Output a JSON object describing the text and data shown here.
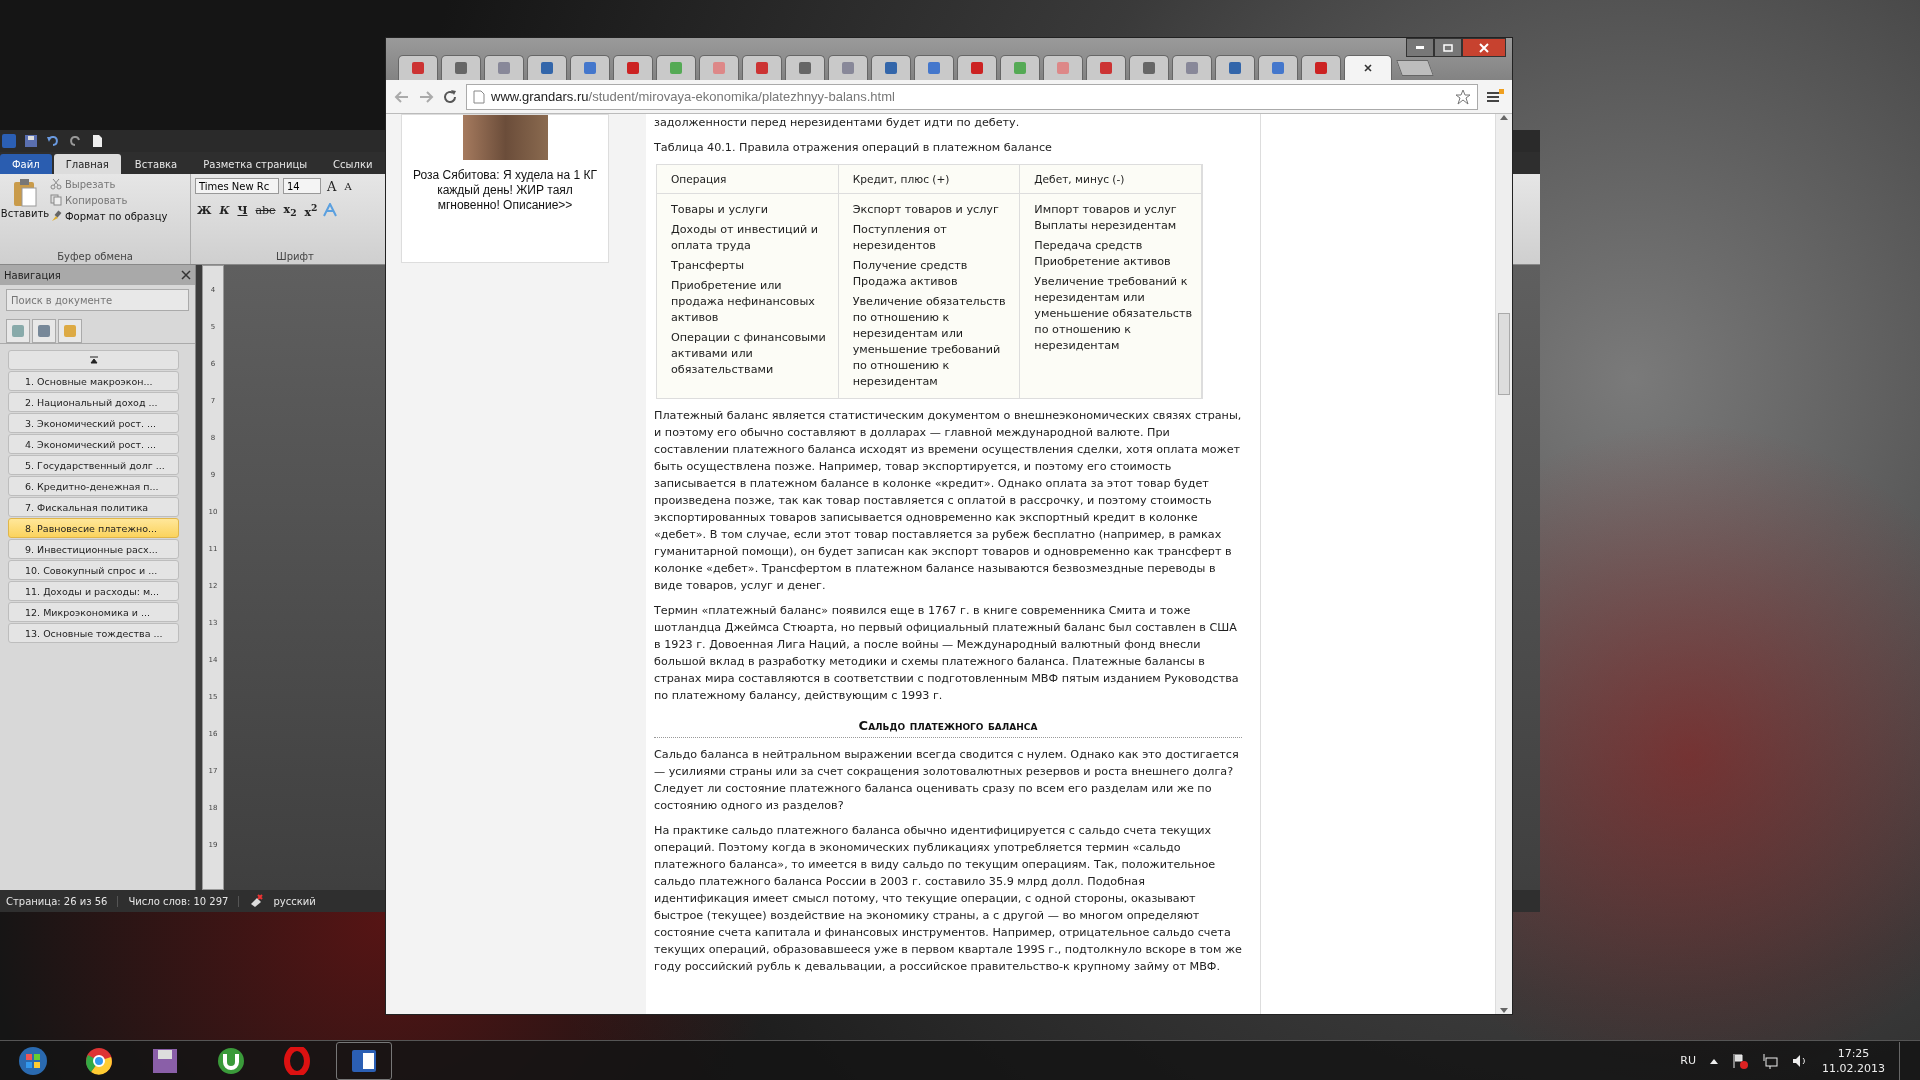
{
  "word": {
    "ribbon_tabs": [
      {
        "label": "Файл",
        "kind": "file",
        "selected": false
      },
      {
        "label": "Главная",
        "kind": "tab",
        "selected": true
      },
      {
        "label": "Вставка",
        "kind": "tab",
        "selected": false
      },
      {
        "label": "Разметка страницы",
        "kind": "tab",
        "selected": false
      },
      {
        "label": "Ссылки",
        "kind": "tab",
        "selected": false
      }
    ],
    "clipboard": {
      "paste": "Вставить",
      "cut": "Вырезать",
      "copy": "Копировать",
      "format_painter": "Формат по образцу",
      "group_label": "Буфер обмена"
    },
    "font": {
      "name": "Times New Rc",
      "size": "14",
      "grow": "A",
      "shrink": "A",
      "bold": "Ж",
      "italic": "К",
      "underline": "Ч",
      "strike": "abe",
      "subscript": "x$_{2}$",
      "superscript": "x$^{2}$",
      "group_label": "Шрифт"
    },
    "navigation": {
      "title": "Навигация",
      "search": {
        "placeholder": "Поиск в документе"
      },
      "items": [
        {
          "label": "1. Основные макроэкон...",
          "selected": false
        },
        {
          "label": "2. Национальный доход ...",
          "selected": false
        },
        {
          "label": "3. Экономический рост. ...",
          "selected": false
        },
        {
          "label": "4. Экономический рост. ...",
          "selected": false
        },
        {
          "label": "5. Государственный долг ...",
          "selected": false
        },
        {
          "label": "6. Кредитно-денежная п...",
          "selected": false
        },
        {
          "label": "7. Фискальная политика",
          "selected": false
        },
        {
          "label": "8. Равновесие платежно...",
          "selected": true
        },
        {
          "label": "9. Инвестиционные расх...",
          "selected": false
        },
        {
          "label": "10. Совокупный спрос и ...",
          "selected": false
        },
        {
          "label": "11. Доходы и расходы: м...",
          "selected": false
        },
        {
          "label": "12. Микроэкономика и ...",
          "selected": false
        },
        {
          "label": "13. Основные тождества ...",
          "selected": false
        }
      ]
    },
    "ruler": [
      "4",
      "5",
      "6",
      "7",
      "8",
      "9",
      "10",
      "11",
      "12",
      "13",
      "14",
      "15",
      "16",
      "17",
      "18",
      "19"
    ],
    "status_bar": {
      "page": "Страница: 26 из 56",
      "words": "Число слов: 10 297",
      "language": "русский"
    }
  },
  "browser": {
    "tabs": [
      {
        "selected": false
      },
      {
        "selected": false
      },
      {
        "selected": false
      },
      {
        "selected": false
      },
      {
        "selected": false
      },
      {
        "selected": false
      },
      {
        "selected": false
      },
      {
        "selected": false
      },
      {
        "selected": false
      },
      {
        "selected": false
      },
      {
        "selected": false
      },
      {
        "selected": false
      },
      {
        "selected": false
      },
      {
        "selected": false
      },
      {
        "selected": false
      },
      {
        "selected": false
      },
      {
        "selected": false
      },
      {
        "selected": false
      },
      {
        "selected": false
      },
      {
        "selected": false
      },
      {
        "selected": false
      },
      {
        "selected": false
      },
      {
        "selected": true
      }
    ],
    "address": {
      "host": "www.grandars.ru",
      "path": "/student/mirovaya-ekonomika/platezhnyy-balans.html"
    },
    "ad": {
      "caption": "Роза Сябитова: Я худела на 1 КГ каждый день! ЖИР таял мгновенно! Описание>>"
    },
    "article": {
      "lead": "задолженности перед нерезидентами будет идти по дебету.",
      "table": {
        "caption": "Таблица 40.1. Правила отражения операций в платежном балансе",
        "columns": [
          "Операция",
          "Кредит, плюс (+)",
          "Дебет, минус (-)"
        ],
        "cells": [
          [
            "Товары и услуги",
            "Доходы от инвестиций и оплата труда",
            "Трансферты",
            "Приобретение или продажа нефинансовых активов",
            "Операции с финансовыми активами или обязательствами"
          ],
          [
            "Экспорт товаров и услуг",
            "Поступления от нерезидентов",
            "Получение средств Продажа активов",
            "Увеличение обязательств по отношению к нерезидентам или уменьшение требований по отношению к нерезидентам"
          ],
          [
            "Импорт товаров и услуг Выплаты нерезидентам",
            "Передача средств Приобретение активов",
            "Увеличение требований к нерезидентам или уменьшение обязательств по отношению к нерезидентам"
          ]
        ]
      },
      "paragraphs": [
        "Платежный баланс является статистическим документом о внешнеэкономических связях страны, и поэтому его обычно составляют в долларах — главной международной валюте. При составлении платежного баланса исходят из времени осуществления сделки, хотя оплата может быть осуществлена позже. Например, товар экспортируется, и поэтому его стоимость записывается в платежном балансе в колонке «кредит». Однако оплата за этот товар будет произведена позже, так как товар поставляется с оплатой в рассрочку, и поэтому стоимость экспортированных товаров записывается одновременно как экспортный кредит в колонке «дебет». В том случае, если этот товар поставляется за рубеж бесплатно (например, в рамках гуманитарной помощи), он будет записан как экспорт товаров и одновременно как трансферт в колонке «дебет». Трансфертом в платежном балансе называются безвозмездные переводы в виде товаров, услуг и денег.",
        "Термин «платежный баланс» появился еще в 1767 г. в книге современника Смита и тоже шотландца Джеймса Стюарта, но первый официальный платежный баланс был составлен в США в 1923 г. Довоенная Лига Наций, а после войны — Международный валютный фонд внесли большой вклад в разработку методики и схемы платежного баланса. Платежные балансы в странах мира составляются в соответствии с подготовленным МВФ пятым изданием Руководства по платежному балансу, действующим с 1993 г."
      ],
      "heading": "Сальдо платежного баланса",
      "paragraphs_2": [
        "Сальдо баланса в нейтральном выражении всегда сводится с нулем. Однако как это достигается — усилиями страны или за счет сокращения золотовалютных резервов и роста внешнего долга? Следует ли состояние платежного баланса оценивать сразу по всем его разделам или же по состоянию одного из разделов?",
        "На практике сальдо платежного баланса обычно идентифицируется с сальдо счета текущих операций. Поэтому когда в экономических публикациях употребляется термин «сальдо платежного баланса», то имеется в виду сальдо по текущим операциям. Так, положительное сальдо платежного баланса России в 2003 г. составило 35.9 млрд долл. Подобная идентификация имеет смысл потому, что текущие операции, с одной стороны, оказывают быстрое (текущее) воздействие на экономику страны, а с другой — во многом определяют состояние счета капитала и финансовых инструментов. Например, отрицательное сальдо счета текущих операций, образовавшееся уже в первом квартале 199S г., подтолкнуло вскоре в том же году российский рубль к девальвации, а российское правительство-к крупному займу от МВФ."
      ]
    }
  },
  "taskbar": {
    "language": "RU",
    "time": "17:25",
    "date": "11.02.2013"
  }
}
